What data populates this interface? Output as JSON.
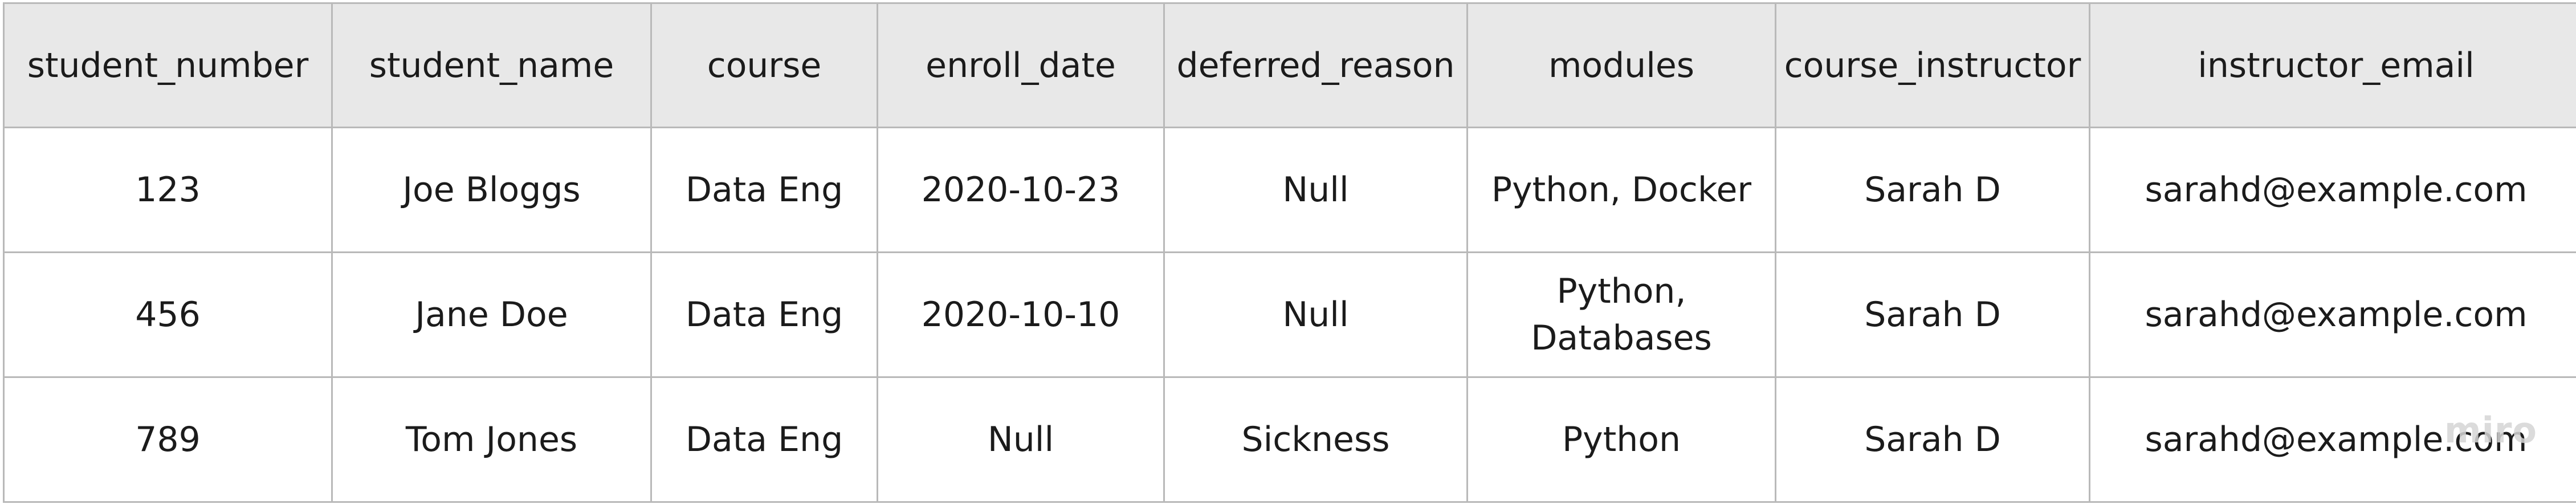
{
  "table": {
    "columns": [
      "student_number",
      "student_name",
      "course",
      "enroll_date",
      "deferred_reason",
      "modules",
      "course_instructor",
      "instructor_email"
    ],
    "rows": [
      [
        "123",
        "Joe Bloggs",
        "Data Eng",
        "2020-10-23",
        "Null",
        "Python, Docker",
        "Sarah D",
        "sarahd@example.com"
      ],
      [
        "456",
        "Jane Doe",
        "Data Eng",
        "2020-10-10",
        "Null",
        "Python, Databases",
        "Sarah D",
        "sarahd@example.com"
      ],
      [
        "789",
        "Tom Jones",
        "Data Eng",
        "Null",
        "Sickness",
        "Python",
        "Sarah D",
        "sarahd@example.com"
      ]
    ]
  },
  "watermark": "miro",
  "colors": {
    "header_background": "#e8e8e8",
    "cell_background": "#ffffff",
    "border": "#b9b9b9",
    "text": "#1b1b1b",
    "watermark": "#d5d5d5"
  }
}
